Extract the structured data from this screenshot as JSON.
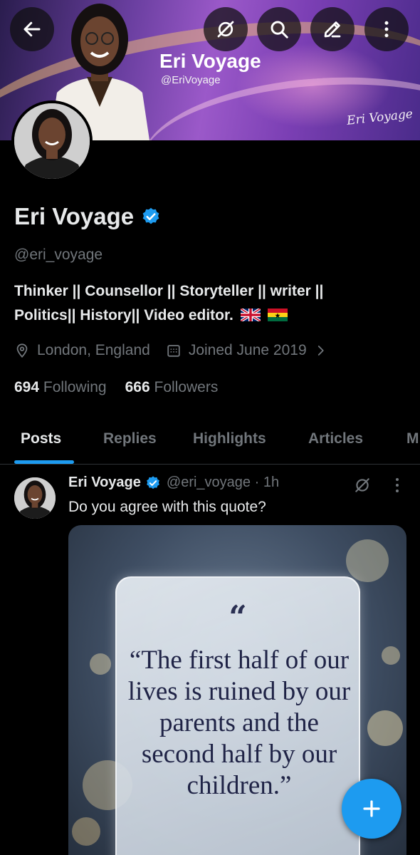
{
  "banner": {
    "name": "Eri Voyage",
    "handle": "@EriVoyage",
    "signature": "Eri Voyage"
  },
  "toolbar": {
    "back": "back-arrow-icon",
    "grok": "grok-icon",
    "search": "search-icon",
    "edit": "edit-pencil-icon",
    "more": "more-vertical-icon"
  },
  "profile": {
    "display_name": "Eri Voyage",
    "handle": "@eri_voyage",
    "bio_line1": "Thinker || Counsellor || Storyteller || writer ||",
    "bio_line2": "Politics|| History|| Video editor.",
    "location": "London, England",
    "joined": "Joined June 2019",
    "following_count": "694",
    "following_label": "Following",
    "followers_count": "666",
    "followers_label": "Followers"
  },
  "tabs": [
    {
      "label": "Posts",
      "active": true
    },
    {
      "label": "Replies"
    },
    {
      "label": "Highlights"
    },
    {
      "label": "Articles"
    },
    {
      "label": "M"
    }
  ],
  "post": {
    "author": "Eri Voyage",
    "handle_time": "@eri_voyage · 1h",
    "text": "Do you agree with this quote?",
    "quote_mark": "“",
    "quote": "“The first half of our lives is ruined by our parents and the second half by our children.”"
  },
  "colors": {
    "accent": "#1d9bf0",
    "secondary_text": "#71767b",
    "primary_text": "#e7e9ea"
  }
}
